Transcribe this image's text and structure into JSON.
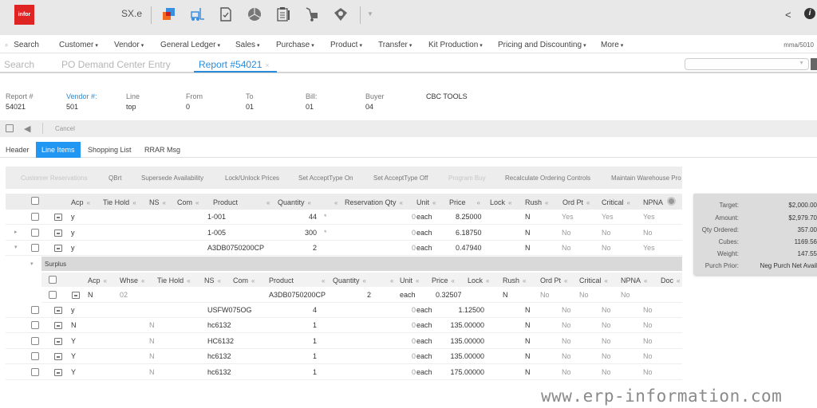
{
  "app": {
    "logo_text": "infor",
    "name": "SX.e",
    "top_icons": [
      "chat-icon",
      "forklift-icon",
      "checklist-icon",
      "pie-chart-icon",
      "clipboard-icon",
      "hand-truck-icon",
      "handshake-icon"
    ],
    "colors": {
      "brand": "#e02424",
      "accent": "#2196f3",
      "link": "#2b8bd8"
    }
  },
  "menu": {
    "search_label": "Search",
    "items": [
      {
        "label": "Customer"
      },
      {
        "label": "Vendor"
      },
      {
        "label": "General Ledger"
      },
      {
        "label": "Sales"
      },
      {
        "label": "Purchase"
      },
      {
        "label": "Product"
      },
      {
        "label": "Transfer"
      },
      {
        "label": "Kit Production"
      },
      {
        "label": "Pricing and Discounting"
      },
      {
        "label": "More"
      }
    ],
    "user": "mma/5010"
  },
  "page_tabs": [
    {
      "label": "Search"
    },
    {
      "label": "PO Demand Center Entry"
    },
    {
      "label": "Report #54021",
      "close": "×"
    }
  ],
  "header_fields": [
    {
      "label": "Report #",
      "value": "54021"
    },
    {
      "label": "Vendor #:",
      "value": "501"
    },
    {
      "label": "Line",
      "value": "top"
    },
    {
      "label": "From",
      "value": "0"
    },
    {
      "label": "To",
      "value": "01"
    },
    {
      "label": "Bill:",
      "value": "01"
    },
    {
      "label": "Buyer",
      "value": "04"
    },
    {
      "label": "CBC TOOLS",
      "value": ""
    }
  ],
  "toolbar": {
    "cancel_label": "Cancel"
  },
  "sub_tabs": [
    {
      "label": "Header"
    },
    {
      "label": "Line Items"
    },
    {
      "label": "Shopping List"
    },
    {
      "label": "RRAR Msg"
    }
  ],
  "actions": [
    {
      "label": "Customer Reservations"
    },
    {
      "label": "QBrt"
    },
    {
      "label": "Supersede Availability"
    },
    {
      "label": "Lock/Unlock Prices"
    },
    {
      "label": "Set AcceptType On"
    },
    {
      "label": "Set AcceptType Off"
    },
    {
      "label": "Program Buy"
    },
    {
      "label": "Recalculate Ordering Controls"
    },
    {
      "label": "Maintain Warehouse Pro"
    }
  ],
  "grid": {
    "columns": [
      "Acp",
      "Tie Hold",
      "NS",
      "Com",
      "Product",
      "Quantity",
      "",
      "Reservation Qty",
      "Unit",
      "Price",
      "Lock",
      "Rush",
      "Ord Pt",
      "Critical",
      "NPNA"
    ],
    "rows": [
      {
        "acp": "y",
        "tiehold": "",
        "product": "1-001",
        "quantity": "44",
        "flag": "*",
        "resqty": "0",
        "unit": "each",
        "price": "8.25000",
        "rush": "N",
        "ordpt": "Yes",
        "critical": "Yes",
        "npna": "Yes",
        "expander": ""
      },
      {
        "acp": "y",
        "tiehold": "",
        "product": "1-005",
        "quantity": "300",
        "flag": "*",
        "resqty": "0",
        "unit": "each",
        "price": "6.18750",
        "rush": "N",
        "ordpt": "No",
        "critical": "No",
        "npna": "No",
        "expander": "▸"
      },
      {
        "acp": "y",
        "tiehold": "",
        "product": "A3DB0750200CP",
        "quantity": "2",
        "flag": "",
        "resqty": "0",
        "unit": "each",
        "price": "0.47940",
        "rush": "N",
        "ordpt": "No",
        "critical": "No",
        "npna": "Yes",
        "expander": "▾"
      }
    ],
    "rows_after": [
      {
        "acp": "y",
        "tiehold": "",
        "product": "USFW075OG",
        "quantity": "4",
        "resqty": "0",
        "unit": "each",
        "price": "1.12500",
        "rush": "N",
        "ordpt": "No",
        "critical": "No",
        "npna": "No"
      },
      {
        "acp": "N",
        "tiehold": "N",
        "product": "hc6132",
        "quantity": "1",
        "resqty": "0",
        "unit": "each",
        "price": "135.00000",
        "rush": "N",
        "ordpt": "No",
        "critical": "No",
        "npna": "No"
      },
      {
        "acp": "Y",
        "tiehold": "N",
        "product": "HC6132",
        "quantity": "1",
        "resqty": "0",
        "unit": "each",
        "price": "135.00000",
        "rush": "N",
        "ordpt": "No",
        "critical": "No",
        "npna": "No"
      },
      {
        "acp": "Y",
        "tiehold": "N",
        "product": "hc6132",
        "quantity": "1",
        "resqty": "0",
        "unit": "each",
        "price": "135.00000",
        "rush": "N",
        "ordpt": "No",
        "critical": "No",
        "npna": "No"
      },
      {
        "acp": "Y",
        "tiehold": "N",
        "product": "hc6132",
        "quantity": "1",
        "resqty": "0",
        "unit": "each",
        "price": "175.00000",
        "rush": "N",
        "ordpt": "No",
        "critical": "No",
        "npna": "No"
      }
    ]
  },
  "surplus": {
    "label": "Surplus",
    "columns": [
      "Acp",
      "Whse",
      "Tie Hold",
      "NS",
      "Com",
      "Product",
      "Quantity",
      "",
      "Unit",
      "Price",
      "Lock",
      "Rush",
      "Ord Pt",
      "Critical",
      "NPNA",
      "Doc"
    ],
    "row": {
      "acp": "N",
      "whse": "02",
      "product": "A3DB0750200CP",
      "quantity": "2",
      "unit": "each",
      "price": "0.32507",
      "rush": "N",
      "ordpt": "No",
      "critical": "No",
      "npna": "No"
    }
  },
  "summary": [
    {
      "label": "Target:",
      "value": "$2,000.00"
    },
    {
      "label": "Amount:",
      "value": "$2,979.70"
    },
    {
      "label": "Qty Ordered:",
      "value": "357.00"
    },
    {
      "label": "Cubes:",
      "value": "1169.56"
    },
    {
      "label": "Weight:",
      "value": "147.55"
    },
    {
      "label": "Purch Prior:",
      "value": "Neg Purch Net Avail"
    }
  ],
  "watermark": "www.erp-information.com"
}
